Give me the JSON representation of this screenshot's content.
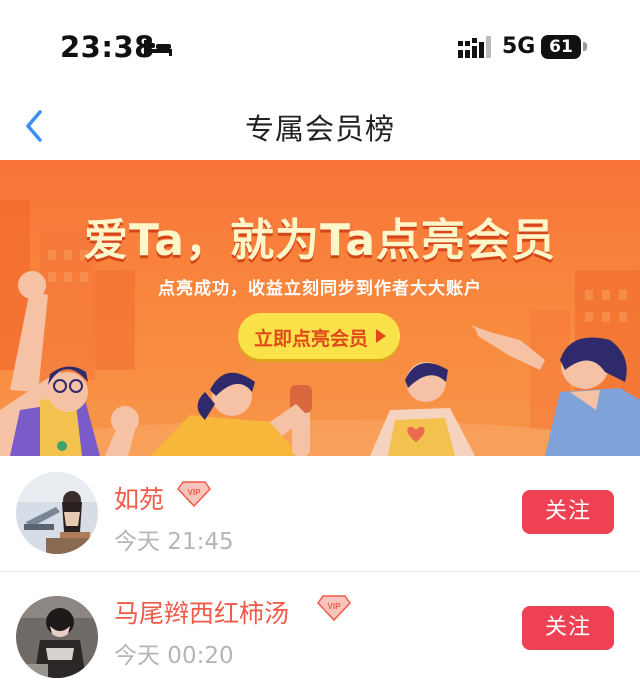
{
  "status_bar": {
    "time": "23:38",
    "network": "5G",
    "battery": "61",
    "icons": [
      "bed-icon",
      "signal-icon",
      "battery-icon"
    ]
  },
  "header": {
    "title": "专属会员榜",
    "back_icon": "chevron-left-icon"
  },
  "banner": {
    "headline": "爱Ta，就为Ta点亮会员",
    "subtitle": "点亮成功，收益立刻同步到作者大大账户",
    "cta": "立即点亮会员"
  },
  "members": [
    {
      "name": "如苑",
      "time": "今天 21:45",
      "follow_label": "关注",
      "badge": "VIP"
    },
    {
      "name": "马尾辫西红柿汤",
      "time": "今天 00:20",
      "follow_label": "关注",
      "badge": "VIP"
    }
  ],
  "colors": {
    "accent_red": "#ee4154",
    "name_color": "#ef5b48",
    "banner_orange": "#f8743a",
    "cta_yellow": "#fbe14a",
    "back_blue": "#3b8ff0"
  }
}
